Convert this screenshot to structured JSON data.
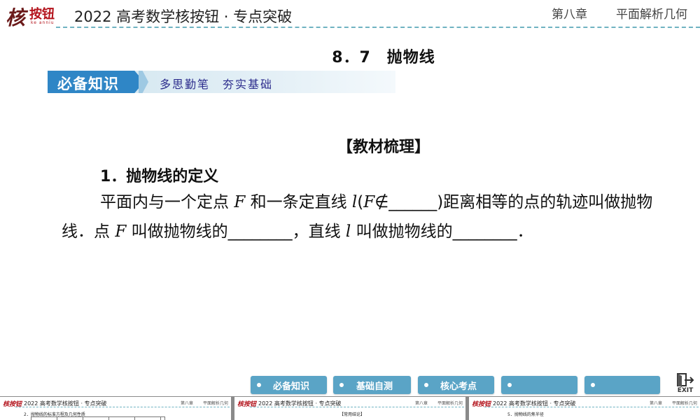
{
  "header": {
    "logo_script": "核",
    "logo_brand": "按钮",
    "logo_sub": "ke anniu",
    "title": "2022 高考数学核按钮 · 专点突破",
    "chapter": "第八章",
    "section": "平面解析几何"
  },
  "section_title": "8．7　抛物线",
  "banner": {
    "tab_label": "必备知识",
    "slogan": "多思勤笔　夯实基础"
  },
  "content": {
    "subsection": "【教材梳理】",
    "item_heading": "1．抛物线的定义",
    "p1": "平面内与一个定点 ",
    "var_F": "F",
    "p2": " 和一条定直线 ",
    "var_l": "l",
    "p3": "(",
    "var_F2": "F",
    "p4": "∉______)距离相等的点的轨迹叫做抛物线．点 ",
    "var_F3": "F",
    "p5": " 叫做抛物线的________，直线 ",
    "var_l2": "l",
    "p6": " 叫做抛物线的________．"
  },
  "nav": {
    "items": [
      "必备知识",
      "基础自测",
      "核心考点",
      "",
      ""
    ]
  },
  "exit_label": "EXIT",
  "thumbnails": [
    {
      "logo": "核按钮",
      "title": "2022 高考数学核按钮 · 专点突破",
      "chapter": "第八章",
      "section": "平面解析几何",
      "text": "2．抛物线的标准方程及几何性质"
    },
    {
      "logo": "核按钮",
      "title": "2022 高考数学核按钮 · 专点突破",
      "chapter": "第八章",
      "section": "平面解析几何",
      "text": "【常用结论】"
    },
    {
      "logo": "核按钮",
      "title": "2022 高考数学核按钮 · 专点突破",
      "chapter": "第八章",
      "section": "平面解析几何",
      "text": "5．抛物线的焦半径"
    }
  ]
}
